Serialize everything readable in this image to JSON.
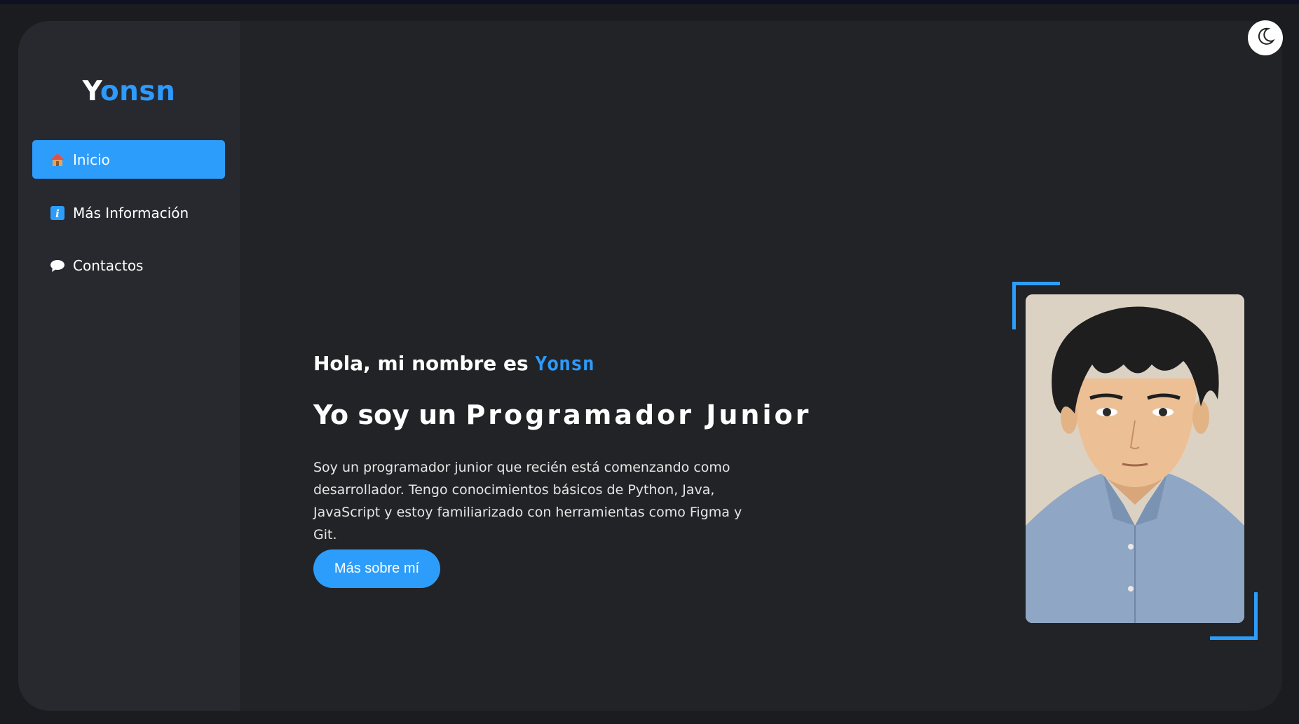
{
  "brand": {
    "first_letter": "Y",
    "rest": "onsn"
  },
  "sidebar": {
    "items": [
      {
        "label": "Inicio",
        "icon": "house-icon",
        "active": true
      },
      {
        "label": "Más Información",
        "icon": "info-icon",
        "active": false
      },
      {
        "label": "Contactos",
        "icon": "speech-bubble-icon",
        "active": false
      }
    ]
  },
  "hero": {
    "greeting_prefix": "Hola, mi nombre es",
    "name": "Yonsn",
    "role_prefix": "Yo soy un",
    "role": "Programador Junior",
    "description": "Soy un programador junior que recién está comenzando como desarrollador. Tengo conocimientos básicos de Python, Java, JavaScript y estoy familiarizado con herramientas como Figma y Git.",
    "cta_label": "Más sobre mí"
  },
  "theme_toggle": {
    "icon": "moon-icon"
  },
  "colors": {
    "accent": "#2d9dfc",
    "background": "#222326",
    "sidebar": "#28292e",
    "text": "#ffffff"
  }
}
